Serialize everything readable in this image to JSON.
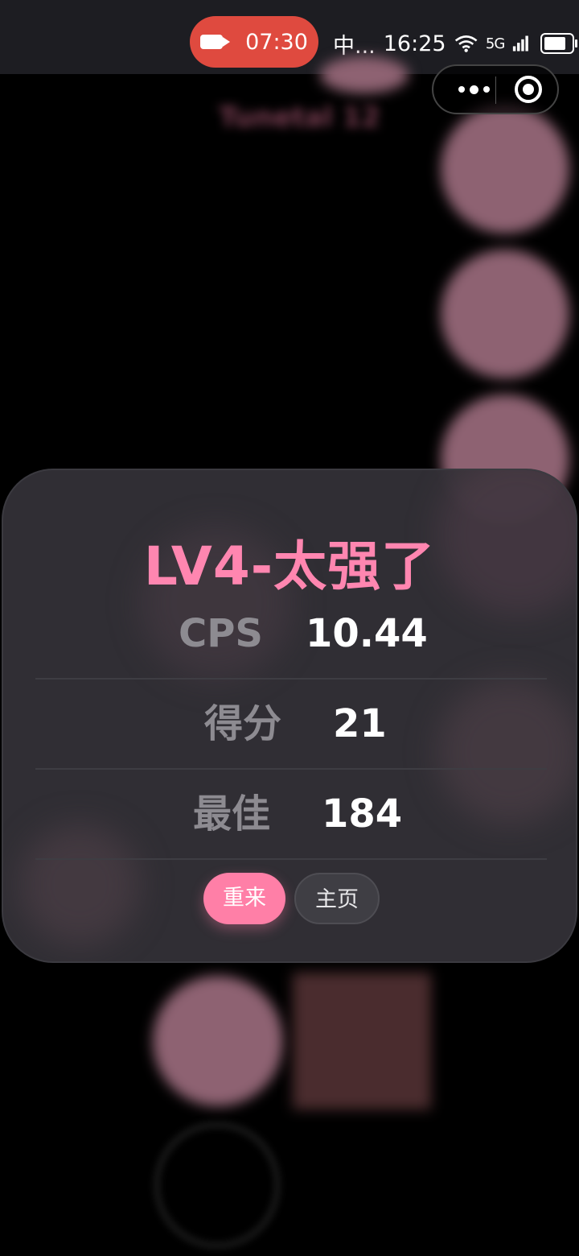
{
  "status_bar": {
    "recording_time": "07:30",
    "carrier": "中...",
    "clock": "16:25",
    "network": "5G"
  },
  "capsule": {
    "more_icon": "more-dots-icon",
    "close_icon": "target-circle-icon"
  },
  "background": {
    "blurred_label": "Tunetal 12"
  },
  "result": {
    "title": "LV4-太强了",
    "stats": [
      {
        "label": "CPS",
        "value": "10.44"
      },
      {
        "label": "得分",
        "value": "21"
      },
      {
        "label": "最佳",
        "value": "184"
      }
    ],
    "retry_label": "重来",
    "home_label": "主页"
  },
  "colors": {
    "accent": "#ff86b0",
    "retry_button": "#ff7fa7",
    "record_pill": "#df4a3f",
    "card_bg": "#323036"
  }
}
